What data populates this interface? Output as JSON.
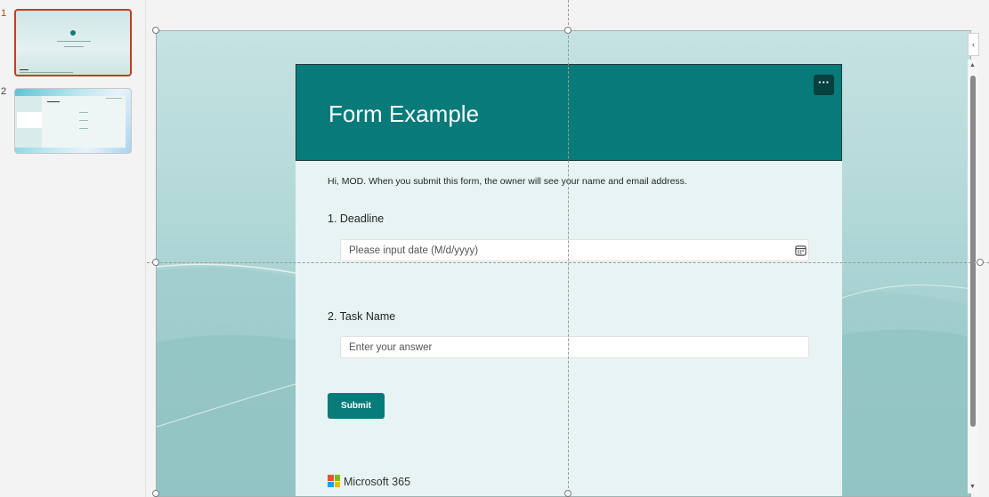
{
  "thumbnails": [
    {
      "number": "1",
      "active": true
    },
    {
      "number": "2",
      "active": false
    }
  ],
  "form": {
    "title": "Form Example",
    "more_label": "···",
    "intro": "Hi, MOD. When you submit this form, the owner will see your name and email address.",
    "questions": [
      {
        "label": "1. Deadline",
        "placeholder": "Please input date (M/d/yyyy)",
        "icon": "calendar-icon"
      },
      {
        "label": "2. Task Name",
        "placeholder": "Enter your answer"
      }
    ],
    "submit_label": "Submit",
    "footer_brand": "Microsoft 365"
  },
  "panel": {
    "collapse_label": "‹",
    "scroll_up": "▲",
    "scroll_down": "▼"
  },
  "colors": {
    "accent": "#077a7a",
    "selection": "#c43e1c",
    "ms_red": "#f25022",
    "ms_green": "#7fba00",
    "ms_blue": "#00a4ef",
    "ms_yellow": "#ffb900"
  }
}
